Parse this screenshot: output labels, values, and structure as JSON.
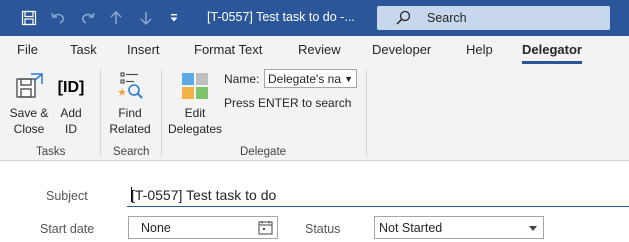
{
  "window": {
    "title": "[T-0557] Test task to do  -...",
    "search_placeholder": "Search",
    "accent": "#2b579a"
  },
  "quick_access": [
    "save-icon",
    "undo-icon",
    "redo-icon",
    "up-arrow-icon",
    "down-arrow-icon",
    "customize-icon"
  ],
  "tabs": [
    "File",
    "Task",
    "Insert",
    "Format Text",
    "Review",
    "Developer",
    "Help",
    "Delegator"
  ],
  "active_tab": "Delegator",
  "ribbon": {
    "tasks": {
      "save_close": "Save &\nClose",
      "add_id": "Add\nID",
      "label": "Tasks"
    },
    "search": {
      "find_related": "Find\nRelated",
      "label": "Search"
    },
    "delegate": {
      "edit_delegates": "Edit\nDelegates",
      "name_label": "Name:",
      "name_value": "Delegate's na",
      "hint": "Press ENTER to search",
      "label": "Delegate"
    }
  },
  "form": {
    "subject_label": "Subject",
    "subject_value": "[T-0557] Test task to do",
    "start_date_label": "Start date",
    "start_date_value": "None",
    "status_label": "Status",
    "status_value": "Not Started"
  }
}
